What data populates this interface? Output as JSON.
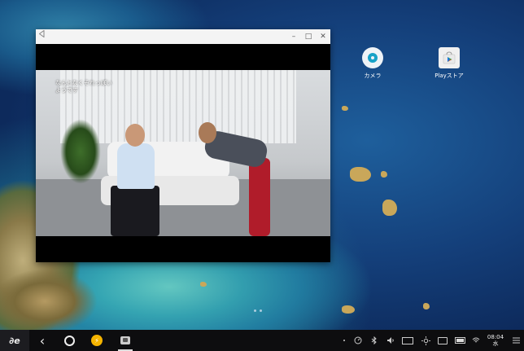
{
  "window": {
    "back_icon": "triangle-back-icon",
    "minimize_glyph": "–",
    "maximize_glyph": "□",
    "close_glyph": "✕",
    "video_caption_line1": "なんとなくそれっぽい",
    "video_caption_line2": "ようです"
  },
  "desktop": {
    "apps": [
      {
        "label": "カメラ",
        "icon": "camera-icon"
      },
      {
        "label": "Playストア",
        "icon": "play-store-icon"
      }
    ],
    "page_count": 2
  },
  "taskbar": {
    "logo_label": "∂e",
    "back_glyph": "‹",
    "home_glyph": "○",
    "app_badge_glyph": "⚡",
    "running_app": "video-app-icon",
    "clock_time": "08:04",
    "clock_day": "水",
    "battery_level": 0.85,
    "colors": {
      "taskbar_bg": "#0d0d0f",
      "accent_yellow": "#f5b400"
    }
  }
}
